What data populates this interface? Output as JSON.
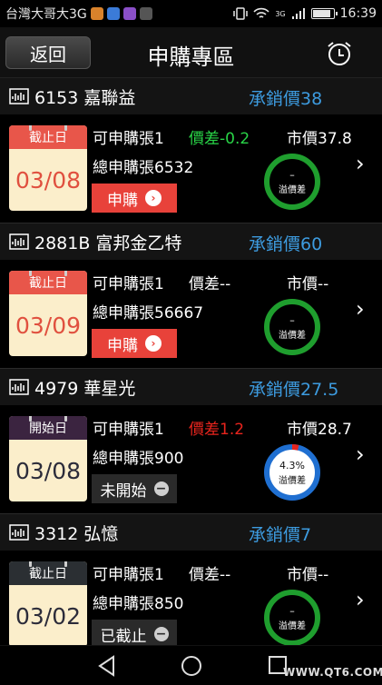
{
  "status_bar": {
    "carrier": "台灣大哥大3G",
    "network": "3G",
    "time": "16:39"
  },
  "header": {
    "back_label": "返回",
    "title": "申購專區",
    "alarm_icon": "alarm-clock-icon"
  },
  "items": [
    {
      "code_name": "6153 嘉聯益",
      "underwrite": "承銷價38",
      "cal_label": "截止日",
      "cal_date": "03/08",
      "qty": "可申購張1",
      "spread": "價差-0.2",
      "market": "市價37.8",
      "total": "總申購張6532",
      "action": "申購",
      "ring_pct": "–",
      "ring_label": "溢價差"
    },
    {
      "code_name": "2881B 富邦金乙特",
      "underwrite": "承銷價60",
      "cal_label": "截止日",
      "cal_date": "03/09",
      "qty": "可申購張1",
      "spread": "價差--",
      "market": "市價--",
      "total": "總申購張56667",
      "action": "申購",
      "ring_pct": "–",
      "ring_label": "溢價差"
    },
    {
      "code_name": "4979 華星光",
      "underwrite": "承銷價27.5",
      "cal_label": "開始日",
      "cal_date": "03/08",
      "qty": "可申購張1",
      "spread": "價差1.2",
      "market": "市價28.7",
      "total": "總申購張900",
      "action": "未開始",
      "ring_pct": "4.3%",
      "ring_label": "溢價差"
    },
    {
      "code_name": "3312 弘憶",
      "underwrite": "承銷價7",
      "cal_label": "截止日",
      "cal_date": "03/02",
      "qty": "可申購張1",
      "spread": "價差--",
      "market": "市價--",
      "total": "總申購張850",
      "action": "已截止",
      "ring_pct": "–",
      "ring_label": "溢價差"
    }
  ],
  "colors": {
    "accent_blue": "#3d9bdf",
    "apply_red": "#e8423a",
    "spread_green": "#29d447",
    "spread_red": "#e8241d",
    "ring_green": "#1f9e2e",
    "ring_blue": "#1f6fd1"
  },
  "watermark": "WWW.QT6.COM"
}
